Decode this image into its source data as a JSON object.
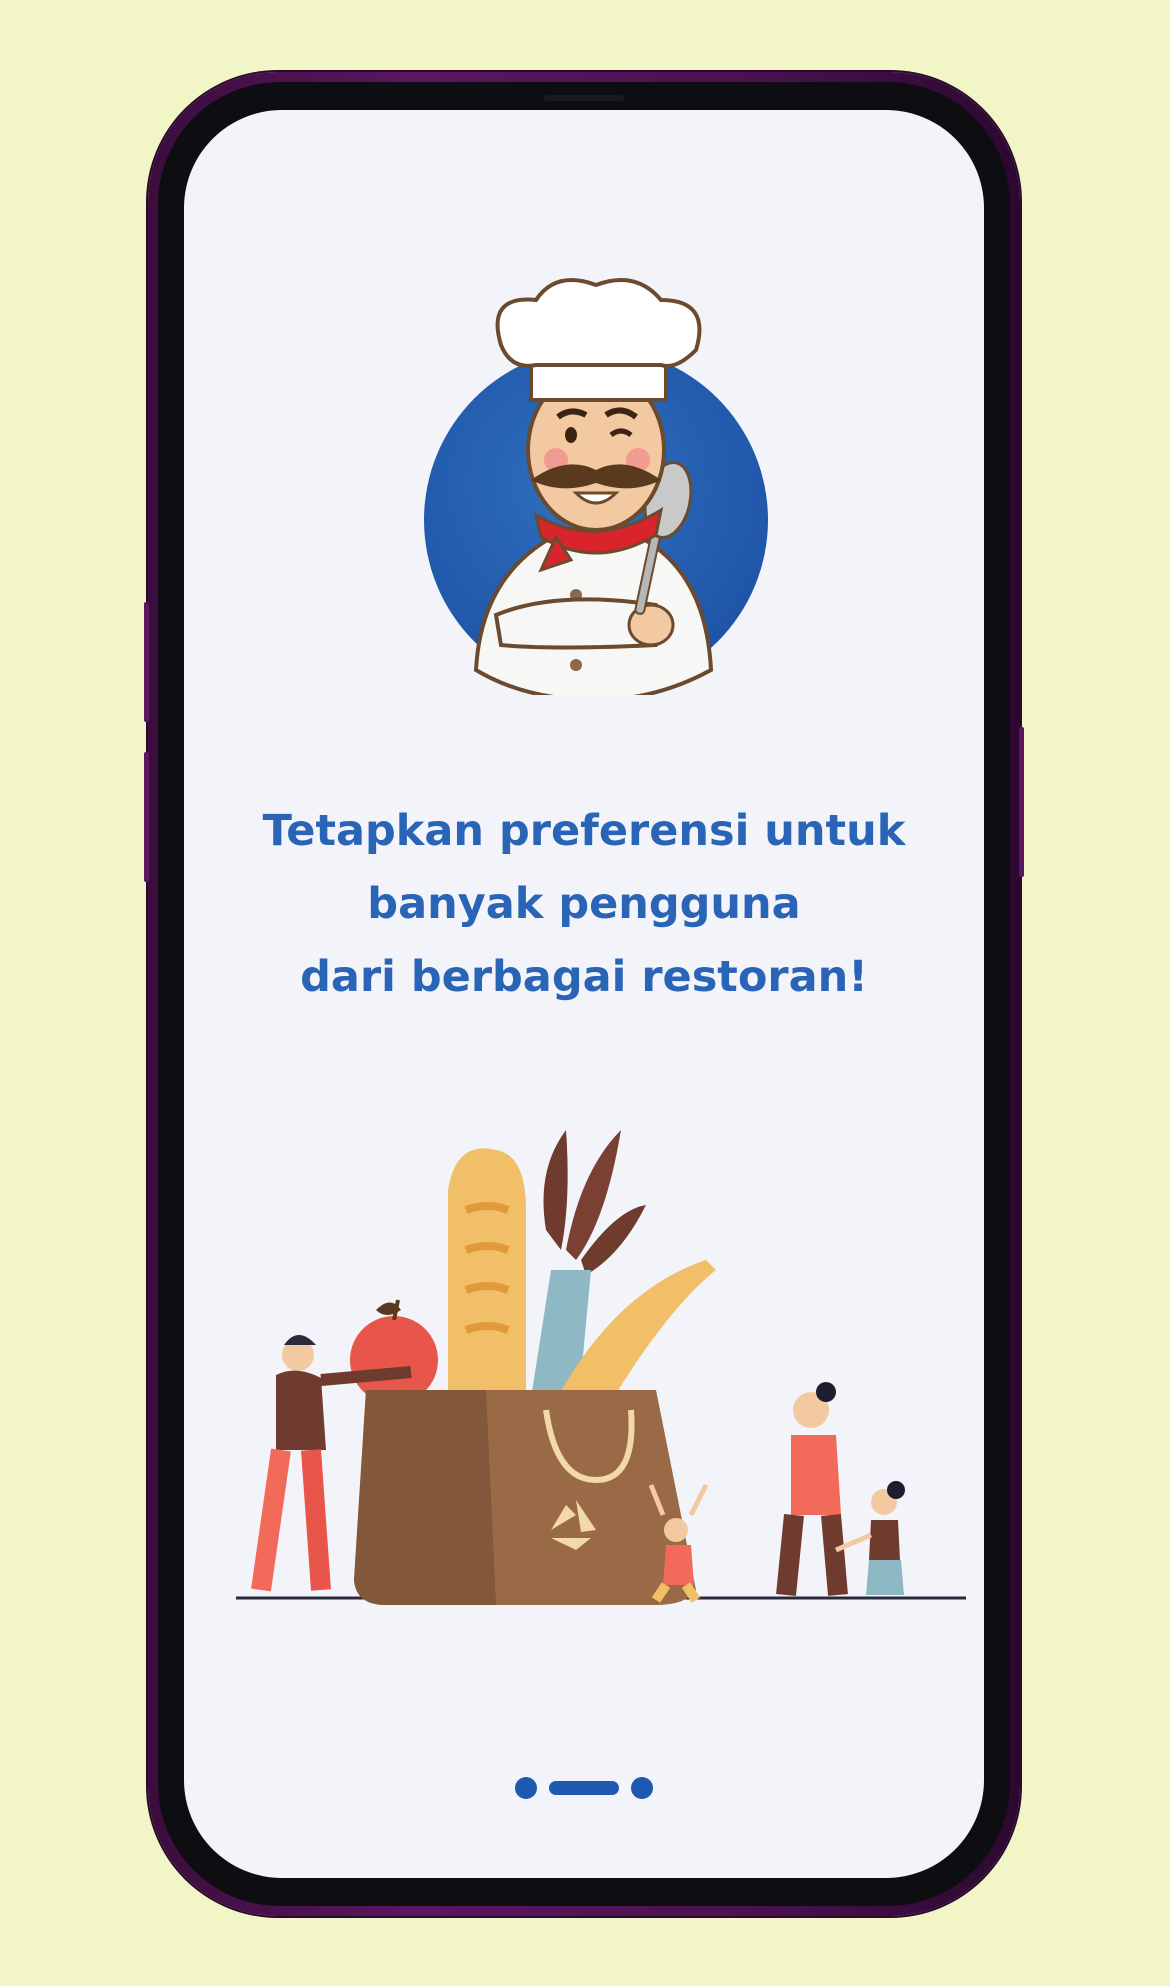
{
  "onboarding": {
    "headline_line1": "Tetapkan preferensi untuk",
    "headline_line2": "banyak pengguna",
    "headline_line3": "dari berbagai restoran!"
  },
  "pagination": {
    "total": 3,
    "active_index": 1
  },
  "colors": {
    "background": "#f2f6c6",
    "screen": "#f3f4f9",
    "accent": "#2a64b6",
    "phone_frame": "#5b1660"
  },
  "icons": {
    "logo": "chef-mascot-logo",
    "illustration": "grocery-bag-family-illustration"
  }
}
